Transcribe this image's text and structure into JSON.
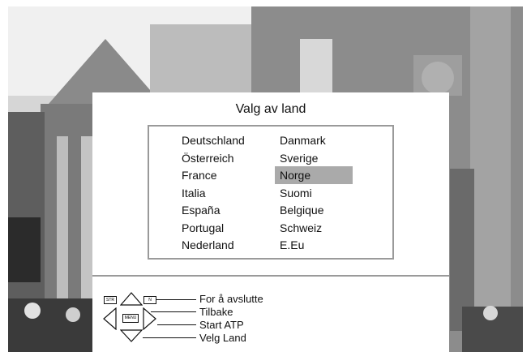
{
  "osd": {
    "title": "Valg av land",
    "countries_left": [
      "Deutschland",
      "Österreich",
      "France",
      "Italia",
      "España",
      "Portugal",
      "Nederland"
    ],
    "countries_right": [
      "Danmark",
      "Sverige",
      "Norge",
      "Suomi",
      "Belgique",
      "Schweiz",
      "E.Eu"
    ],
    "selected": "Norge"
  },
  "legend": {
    "exit": "For å avslutte",
    "back": "Tilbake",
    "start_atp": "Start ATP",
    "select_country": "Velg Land",
    "key_str": "STR",
    "key_n": "N",
    "key_menu": "MENU"
  },
  "colors": {
    "selection": "#aaaaaa",
    "frame": "#9a9a9a",
    "panel": "#ffffff"
  },
  "icons": [
    "up-arrow-icon",
    "down-arrow-icon",
    "left-arrow-icon",
    "right-arrow-icon"
  ]
}
